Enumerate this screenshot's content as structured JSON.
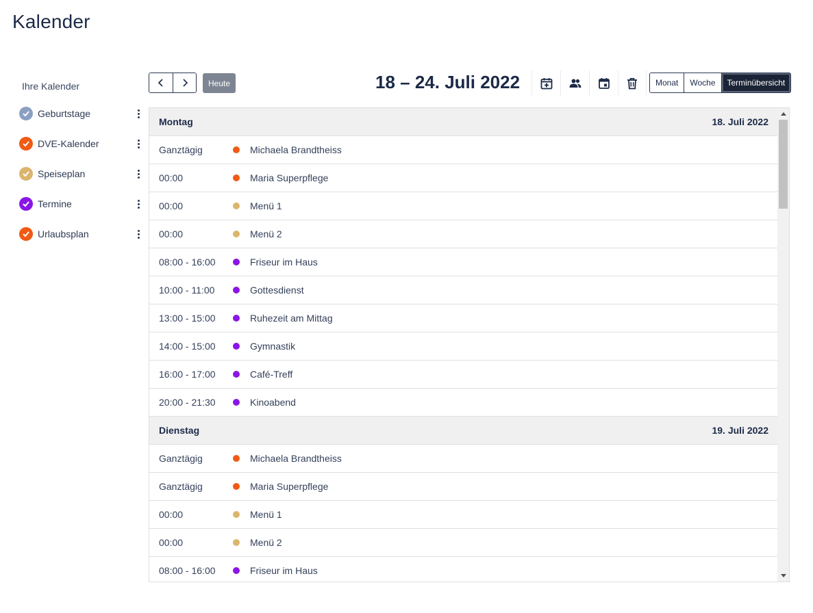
{
  "page": {
    "title": "Kalender"
  },
  "sidebar": {
    "heading": "Ihre Kalender",
    "calendars": [
      {
        "label": "Geburtstage",
        "color": "#8aa0c2"
      },
      {
        "label": "DVE-Kalender",
        "color": "#f05a14"
      },
      {
        "label": "Speiseplan",
        "color": "#dbb56e"
      },
      {
        "label": "Termine",
        "color": "#8a16e6"
      },
      {
        "label": "Urlaubsplan",
        "color": "#f05a14"
      }
    ]
  },
  "toolbar": {
    "prev_icon": "chevron-left-icon",
    "next_icon": "chevron-right-icon",
    "today_label": "Heute",
    "range_title": "18 – 24. Juli 2022",
    "icons": [
      "calendar-add-icon",
      "users-icon",
      "calendar-icon",
      "trash-icon"
    ],
    "views": [
      {
        "label": "Monat",
        "active": false
      },
      {
        "label": "Woche",
        "active": false
      },
      {
        "label": "Terminübersicht",
        "active": true
      }
    ]
  },
  "colors": {
    "orange": "#f05a14",
    "beige": "#dbb56e",
    "purple": "#8a16e6",
    "gray_blue": "#8aa0c2"
  },
  "agenda": [
    {
      "day": "Montag",
      "date": "18. Juli 2022",
      "events": [
        {
          "time": "Ganztägig",
          "title": "Michaela Brandtheiss",
          "color": "#f05a14"
        },
        {
          "time": "00:00",
          "title": "Maria Superpflege",
          "color": "#f05a14"
        },
        {
          "time": "00:00",
          "title": "Menü 1",
          "color": "#dbb56e"
        },
        {
          "time": "00:00",
          "title": "Menü 2",
          "color": "#dbb56e"
        },
        {
          "time": "08:00 - 16:00",
          "title": "Friseur im Haus",
          "color": "#8a16e6"
        },
        {
          "time": "10:00 - 11:00",
          "title": "Gottesdienst",
          "color": "#8a16e6"
        },
        {
          "time": "13:00 - 15:00",
          "title": "Ruhezeit am Mittag",
          "color": "#8a16e6"
        },
        {
          "time": "14:00 - 15:00",
          "title": "Gymnastik",
          "color": "#8a16e6"
        },
        {
          "time": "16:00 - 17:00",
          "title": "Café-Treff",
          "color": "#8a16e6"
        },
        {
          "time": "20:00 - 21:30",
          "title": "Kinoabend",
          "color": "#8a16e6"
        }
      ]
    },
    {
      "day": "Dienstag",
      "date": "19. Juli 2022",
      "events": [
        {
          "time": "Ganztägig",
          "title": "Michaela Brandtheiss",
          "color": "#f05a14"
        },
        {
          "time": "Ganztägig",
          "title": "Maria Superpflege",
          "color": "#f05a14"
        },
        {
          "time": "00:00",
          "title": "Menü 1",
          "color": "#dbb56e"
        },
        {
          "time": "00:00",
          "title": "Menü 2",
          "color": "#dbb56e"
        },
        {
          "time": "08:00 - 16:00",
          "title": "Friseur im Haus",
          "color": "#8a16e6"
        }
      ]
    }
  ]
}
